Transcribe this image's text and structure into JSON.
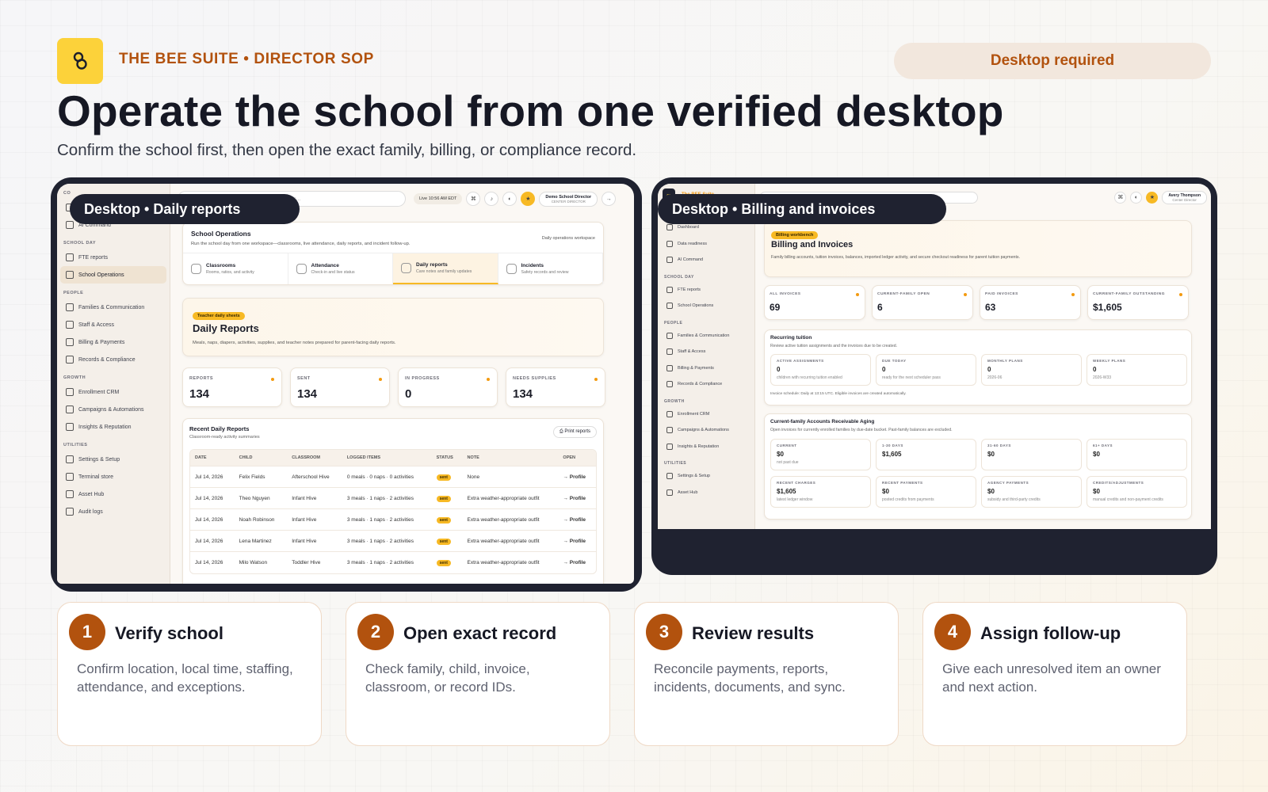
{
  "header": {
    "brand": "THE BEE SUITE • DIRECTOR SOP",
    "badge": "Desktop required",
    "title": "Operate the school from one verified desktop",
    "subtitle": "Confirm the school first, then open the exact family, billing, or compliance record."
  },
  "colors": {
    "accent": "#b2520e",
    "brand_yellow": "#fcd23a",
    "frame": "#1f2230"
  },
  "shot1": {
    "label": "Desktop • Daily reports",
    "search_placeholder": "Search families, children, invoices, tours, tasks...",
    "search_key": "/",
    "live": "Live 10:56 AM EDT",
    "user_name": "Demo School Director",
    "user_role": "CENTER DIRECTOR",
    "sidebar": {
      "sections": [
        {
          "title": "CO",
          "items": [
            "Dashboard",
            "AI Command"
          ]
        },
        {
          "title": "SCHOOL DAY",
          "items": [
            "FTE reports",
            "School Operations"
          ]
        },
        {
          "title": "PEOPLE",
          "items": [
            "Families & Communication",
            "Staff & Access",
            "Billing & Payments",
            "Records & Compliance"
          ]
        },
        {
          "title": "GROWTH",
          "items": [
            "Enrollment CRM",
            "Campaigns & Automations",
            "Insights & Reputation"
          ]
        },
        {
          "title": "UTILITIES",
          "items": [
            "Settings & Setup",
            "Terminal store",
            "Asset Hub",
            "Audit logs"
          ]
        }
      ]
    },
    "ops": {
      "title": "School Operations",
      "desc": "Run the school day from one workspace—classrooms, live attendance, daily reports, and incident follow-up.",
      "tag": "Daily operations workspace",
      "tabs": [
        {
          "title": "Classrooms",
          "sub": "Rooms, ratios, and activity"
        },
        {
          "title": "Attendance",
          "sub": "Check-in and live status"
        },
        {
          "title": "Daily reports",
          "sub": "Care notes and family updates"
        },
        {
          "title": "Incidents",
          "sub": "Safety records and review"
        }
      ]
    },
    "daily": {
      "chip": "Teacher daily sheets",
      "title": "Daily Reports",
      "desc": "Meals, naps, diapers, activities, supplies, and teacher notes prepared for parent-facing daily reports."
    },
    "stats": [
      {
        "label": "REPORTS",
        "value": "134"
      },
      {
        "label": "SENT",
        "value": "134"
      },
      {
        "label": "IN PROGRESS",
        "value": "0"
      },
      {
        "label": "NEEDS SUPPLIES",
        "value": "134"
      }
    ],
    "recent": {
      "title": "Recent Daily Reports",
      "sub": "Classroom-ready activity summaries",
      "print": "Print reports",
      "columns": [
        "DATE",
        "CHILD",
        "CLASSROOM",
        "LOGGED ITEMS",
        "STATUS",
        "NOTE",
        "OPEN"
      ],
      "rows": [
        [
          "Jul 14, 2026",
          "Felix Fields",
          "Afterschool Hive",
          "0 meals · 0 naps · 0 activities",
          "sent",
          "None",
          "→ Profile"
        ],
        [
          "Jul 14, 2026",
          "Theo Nguyen",
          "Infant Hive",
          "3 meals · 1 naps · 2 activities",
          "sent",
          "Extra weather-appropriate outfit",
          "→ Profile"
        ],
        [
          "Jul 14, 2026",
          "Noah Robinson",
          "Infant Hive",
          "3 meals · 1 naps · 2 activities",
          "sent",
          "Extra weather-appropriate outfit",
          "→ Profile"
        ],
        [
          "Jul 14, 2026",
          "Lena Martinez",
          "Infant Hive",
          "3 meals · 1 naps · 2 activities",
          "sent",
          "Extra weather-appropriate outfit",
          "→ Profile"
        ],
        [
          "Jul 14, 2026",
          "Milo Watson",
          "Toddler Hive",
          "3 meals · 1 naps · 2 activities",
          "sent",
          "Extra weather-appropriate outfit",
          "→ Profile"
        ]
      ]
    }
  },
  "shot2": {
    "label": "Desktop • Billing and invoices",
    "brand": "The BEE Suite",
    "search_placeholder": "Search families, children, invoices, tours, tasks...",
    "search_key": "/",
    "user_name": "Avery Thompson",
    "user_role": "Center Director",
    "sidebar": {
      "sections": [
        {
          "title": "COMMAND",
          "items": [
            "Dashboard",
            "Data readiness",
            "AI Command"
          ]
        },
        {
          "title": "SCHOOL DAY",
          "items": [
            "FTE reports",
            "School Operations"
          ]
        },
        {
          "title": "PEOPLE",
          "items": [
            "Families & Communication",
            "Staff & Access",
            "Billing & Payments",
            "Records & Compliance"
          ]
        },
        {
          "title": "GROWTH",
          "items": [
            "Enrollment CRM",
            "Campaigns & Automations",
            "Insights & Reputation"
          ]
        },
        {
          "title": "UTILITIES",
          "items": [
            "Settings & Setup",
            "Asset Hub"
          ]
        }
      ]
    },
    "hero": {
      "chip": "Billing workbench",
      "title": "Billing and Invoices",
      "desc": "Family billing accounts, tuition invoices, balances, imported ledger activity, and secure checkout readiness for parent tuition payments."
    },
    "stats": [
      {
        "label": "ALL INVOICES",
        "value": "69"
      },
      {
        "label": "CURRENT-FAMILY OPEN",
        "value": "6"
      },
      {
        "label": "PAID INVOICES",
        "value": "63"
      },
      {
        "label": "CURRENT-FAMILY OUTSTANDING",
        "value": "$1,605"
      }
    ],
    "tuition": {
      "title": "Recurring tuition",
      "desc": "Review active tuition assignments and the invoices due to be created.",
      "cards": [
        {
          "label": "ACTIVE ASSIGNMENTS",
          "value": "0",
          "desc": "children with recurring tuition enabled"
        },
        {
          "label": "DUE TODAY",
          "value": "0",
          "desc": "ready for the next scheduler pass"
        },
        {
          "label": "MONTHLY PLANS",
          "value": "0",
          "desc": "2026-06"
        },
        {
          "label": "WEEKLY PLANS",
          "value": "0",
          "desc": "2026-W33"
        }
      ],
      "note": "Invoice schedule: Daily at 13:15 UTC. Eligible invoices are created automatically."
    },
    "aging": {
      "title": "Current-family Accounts Receivable Aging",
      "desc": "Open invoices for currently enrolled families by due-date bucket. Past-family balances are excluded.",
      "cards": [
        {
          "label": "CURRENT",
          "value": "$0",
          "desc": "not past due"
        },
        {
          "label": "1-30 DAYS",
          "value": "$1,605",
          "desc": ""
        },
        {
          "label": "31-60 DAYS",
          "value": "$0",
          "desc": ""
        },
        {
          "label": "61+ DAYS",
          "value": "$0",
          "desc": ""
        },
        {
          "label": "RECENT CHARGES",
          "value": "$1,605",
          "desc": "latest ledger window"
        },
        {
          "label": "RECENT PAYMENTS",
          "value": "$0",
          "desc": "posted credits from payments"
        },
        {
          "label": "AGENCY PAYMENTS",
          "value": "$0",
          "desc": "subsidy and third-party credits"
        },
        {
          "label": "CREDITS/ADJUSTMENTS",
          "value": "$0",
          "desc": "manual credits and non-payment credits"
        }
      ]
    }
  },
  "steps": [
    {
      "num": "1",
      "title": "Verify school",
      "text": "Confirm location, local time, staffing, attendance, and exceptions."
    },
    {
      "num": "2",
      "title": "Open exact record",
      "text": "Check family, child, invoice, classroom, or record IDs."
    },
    {
      "num": "3",
      "title": "Review results",
      "text": "Reconcile payments, reports, incidents, documents, and sync."
    },
    {
      "num": "4",
      "title": "Assign follow-up",
      "text": "Give each unresolved item an owner and next action."
    }
  ]
}
